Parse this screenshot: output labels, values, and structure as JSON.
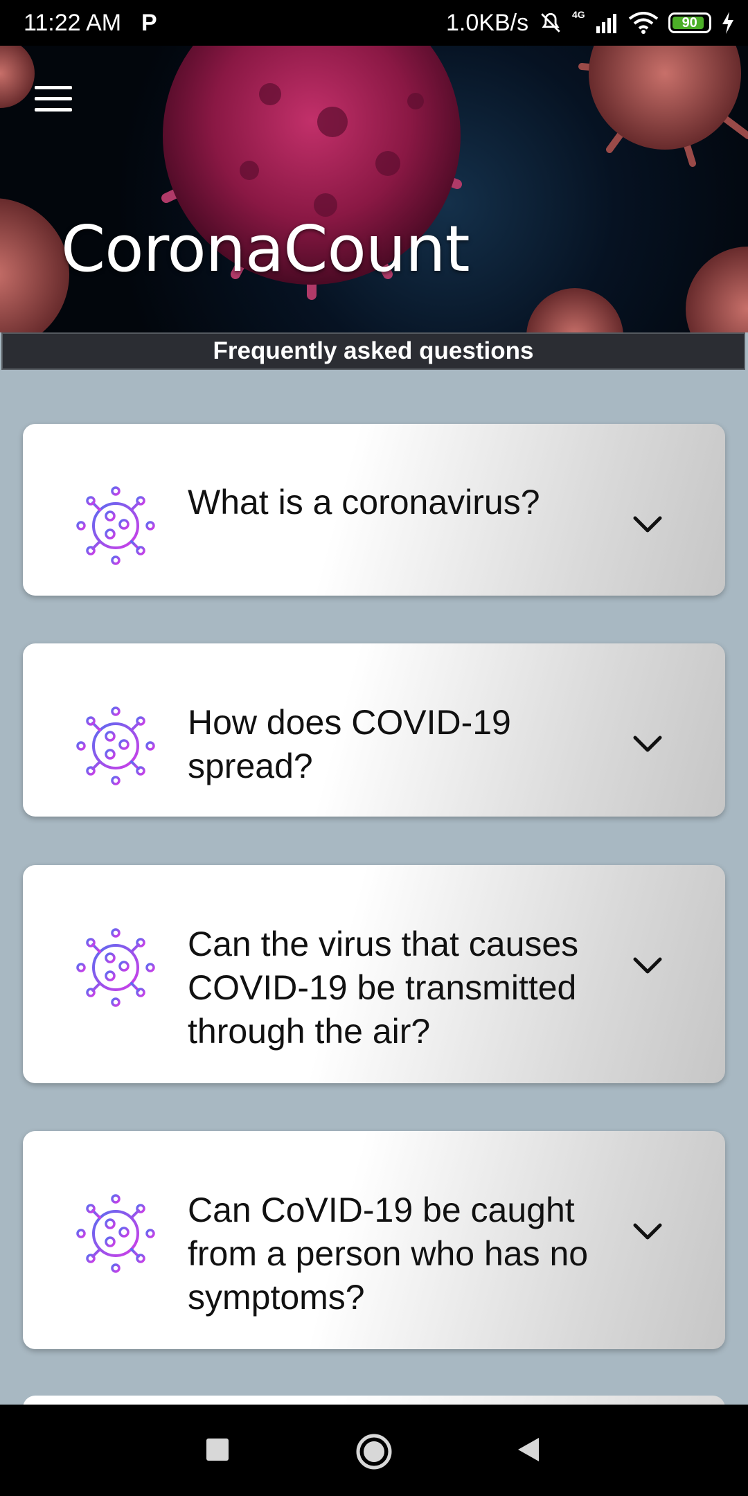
{
  "status_bar": {
    "time": "11:22 AM",
    "notification_icon": "P",
    "network_speed": "1.0KB/s",
    "network_type": "4G",
    "battery_level": "90",
    "battery_fraction": 0.9
  },
  "header": {
    "app_title": "CoronaCount",
    "menu_icon": "hamburger-icon"
  },
  "section": {
    "title": "Frequently asked questions"
  },
  "faq": {
    "items": [
      {
        "question": "What is a coronavirus?",
        "icon": "virus-icon",
        "expanded": false
      },
      {
        "question": "How does COVID-19 spread?",
        "icon": "virus-icon",
        "expanded": false
      },
      {
        "question": "Can the virus that causes COVID-19 be transmitted through the air?",
        "icon": "virus-icon",
        "expanded": false
      },
      {
        "question": "Can CoVID-19 be caught from a person who has no symptoms?",
        "icon": "virus-icon",
        "expanded": false
      }
    ]
  },
  "colors": {
    "header_bg": "#061222",
    "section_bar_bg": "#2b2d33",
    "page_bg": "#a8b8c2",
    "icon_gradient_start": "#5a6cf0",
    "icon_gradient_end": "#d23ce6"
  }
}
